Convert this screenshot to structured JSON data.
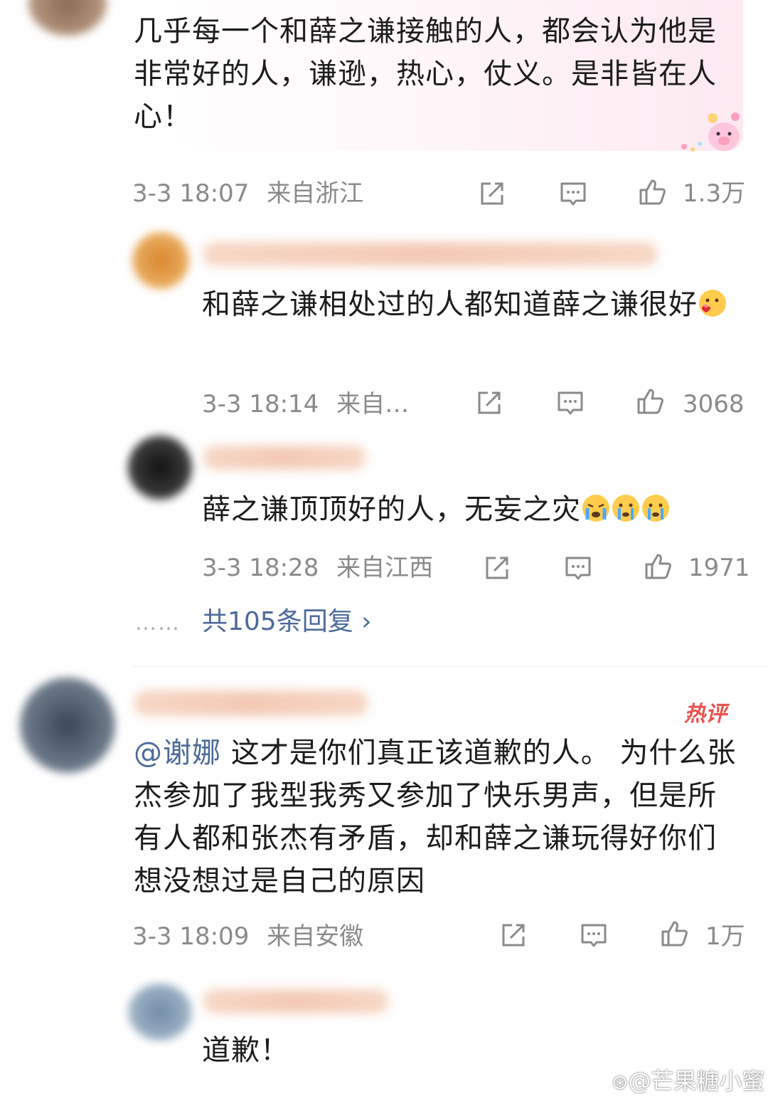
{
  "comments": [
    {
      "text": "几乎每一个和薛之谦接触的人，都会认为他是非常好的人，谦逊，热心，仗义。是非皆在人心！",
      "time": "3-3 18:07",
      "location": "来自浙江",
      "likes": "1.3万",
      "replies": [
        {
          "text": "和薛之谦相处过的人都知道薛之谦很好",
          "time": "3-3 18:14",
          "location": "来自…",
          "likes": "3068"
        },
        {
          "text": "薛之谦顶顶好的人，无妄之灾",
          "time": "3-3 18:28",
          "location": "来自江西",
          "likes": "1971"
        }
      ],
      "more_dots": "……",
      "more_replies": "共105条回复 ›"
    },
    {
      "mention": "@谢娜",
      "text": " 这才是你们真正该道歉的人。 为什么张杰参加了我型我秀又参加了快乐男声，但是所有人都和张杰有矛盾，却和薛之谦玩得好你们想没想过是自己的原因",
      "time": "3-3 18:09",
      "location": "来自安徽",
      "likes": "1万",
      "badge": "热评",
      "replies": [
        {
          "text": "道歉！"
        }
      ]
    }
  ],
  "watermark": "@芒果糖小蜜",
  "colors": {
    "link": "#4d6a9a",
    "meta": "#8a8a8a",
    "hot": "#e8534f"
  },
  "icons": [
    "share-icon",
    "comment-icon",
    "like-icon"
  ]
}
